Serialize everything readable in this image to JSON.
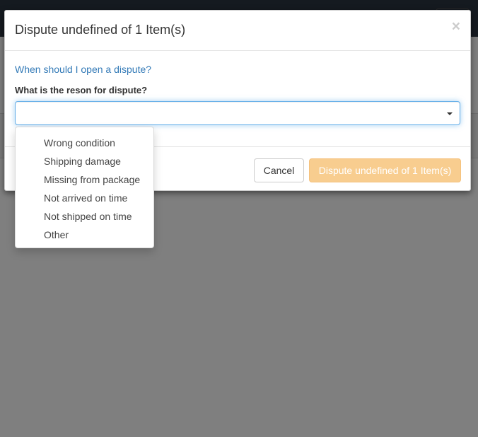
{
  "modal": {
    "title": "Dispute undefined of 1 Item(s)",
    "close_label": "×",
    "help_link": "When should I open a dispute?",
    "reason_label": "What is the reson for dispute?",
    "reason_value": "",
    "cancel_label": "Cancel",
    "submit_label": "Dispute undefined of 1 Item(s)"
  },
  "dropdown": {
    "options": [
      "Wrong condition",
      "Shipping damage",
      "Missing from package",
      "Not arrived on time",
      "Not shipped on time",
      "Other"
    ]
  },
  "colors": {
    "link": "#337ab7",
    "submit_bg": "#f8cd8f",
    "focus_border": "#66afe9",
    "backdrop": "#808080"
  }
}
